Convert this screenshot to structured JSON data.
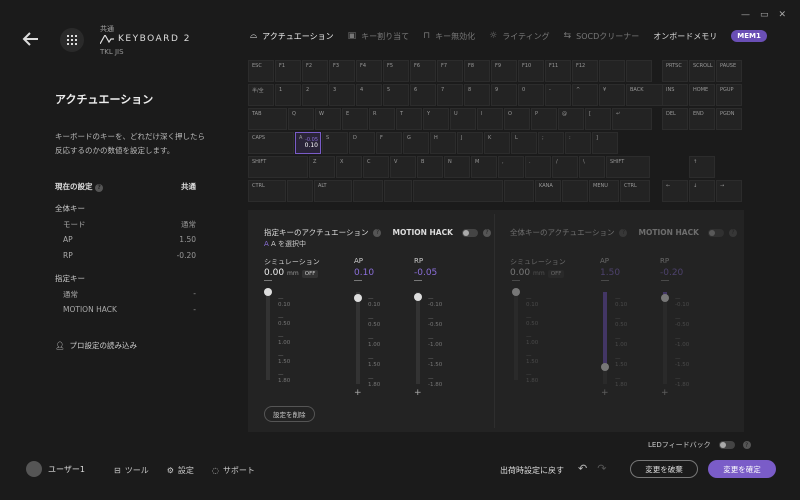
{
  "window": {
    "minimize": "—",
    "maximize": "▭",
    "close": "✕"
  },
  "device": {
    "group": "共通",
    "name": "KEYBOARD 2",
    "layout": "TKL JIS"
  },
  "tabs": [
    {
      "label": "アクチュエーション",
      "active": true
    },
    {
      "label": "キー割り当て"
    },
    {
      "label": "キー無効化"
    },
    {
      "label": "ライティング"
    },
    {
      "label": "SOCDクリーナー"
    },
    {
      "label": "オンボードメモリ"
    }
  ],
  "memory_badge": "MEM1",
  "left": {
    "title": "アクチュエーション",
    "description": "キーボードのキーを、どれだけ深く押したら反応するのかの数値を設定します。",
    "current_label": "現在の設定",
    "current_value": "共通",
    "all_keys": "全体キー",
    "mode_label": "モード",
    "mode_value": "通常",
    "ap_label": "AP",
    "ap_value": "1.50",
    "rp_label": "RP",
    "rp_value": "-0.20",
    "specified": "指定キー",
    "normal_label": "通常",
    "normal_value": "-",
    "mh_label": "MOTION HACK",
    "mh_value": "-",
    "pro_load": "プロ設定の読み込み"
  },
  "keyboard": {
    "row0": [
      "ESC",
      "F1",
      "F2",
      "F3",
      "F4",
      "F5",
      "F6",
      "F7",
      "F8",
      "F9",
      "F10",
      "F11",
      "F12",
      "",
      ""
    ],
    "row1": [
      "半/全",
      "1",
      "2",
      "3",
      "4",
      "5",
      "6",
      "7",
      "8",
      "9",
      "0",
      "-",
      "^",
      "¥",
      "BACK"
    ],
    "row2": [
      "TAB",
      "Q",
      "W",
      "E",
      "R",
      "T",
      "Y",
      "U",
      "I",
      "O",
      "P",
      "@",
      "[",
      "↵"
    ],
    "row3": [
      "CAPS",
      "A",
      "S",
      "D",
      "F",
      "G",
      "H",
      "J",
      "K",
      "L",
      ";",
      ":",
      "]"
    ],
    "row4": [
      "SHIFT",
      "Z",
      "X",
      "C",
      "V",
      "B",
      "N",
      "M",
      ",",
      ".",
      "/",
      "\\",
      "SHIFT"
    ],
    "row5": [
      "CTRL",
      "",
      "ALT",
      "",
      "",
      "",
      "",
      "KANA",
      "",
      "MENU",
      "CTRL"
    ],
    "nav0": [
      "PRTSC",
      "SCROLL",
      "PAUSE"
    ],
    "nav1": [
      "INS",
      "HOME",
      "PGUP"
    ],
    "nav2": [
      "DEL",
      "END",
      "PGDN"
    ],
    "selected_key": "A",
    "selected_rp": "-0.05",
    "selected_ap": "0.10"
  },
  "specified_panel": {
    "title": "指定キーのアクチュエーション",
    "motion_hack": "MOTION HACK",
    "selected": "A を選択中",
    "sim_label": "シミュレーション",
    "sim_value": "0.00",
    "unit": "mm",
    "off": "OFF",
    "ap_label": "AP",
    "ap_value": "0.10",
    "rp_label": "RP",
    "rp_value": "-0.05",
    "reset": "設定を削除"
  },
  "all_panel": {
    "title": "全体キーのアクチュエーション",
    "motion_hack": "MOTION HACK",
    "sim_label": "シミュレーション",
    "sim_value": "0.00",
    "unit": "mm",
    "off": "OFF",
    "ap_label": "AP",
    "ap_value": "1.50",
    "ap_level": 0.82,
    "rp_label": "RP",
    "rp_value": "-0.20",
    "rp_level": 0.06
  },
  "ticks": [
    "0.10",
    "0.50",
    "1.00",
    "1.50",
    "1.80"
  ],
  "ticks_signed": [
    "-0.10",
    "-0.50",
    "-1.00",
    "-1.50",
    "-1.80"
  ],
  "ticks_signed2": [
    "-0.10",
    "-0.50",
    "-1.00",
    "-1.50",
    "-1.80"
  ],
  "footer": {
    "led": "LEDフィードバック",
    "user": "ユーザー1",
    "tools": "ツール",
    "settings": "設定",
    "support": "サポート",
    "factory": "出荷時設定に戻す",
    "discard": "変更を破棄",
    "apply": "変更を確定"
  },
  "colors": {
    "accent": "#7a5cc8",
    "bg": "#1b1b1b",
    "panel": "#232323"
  }
}
